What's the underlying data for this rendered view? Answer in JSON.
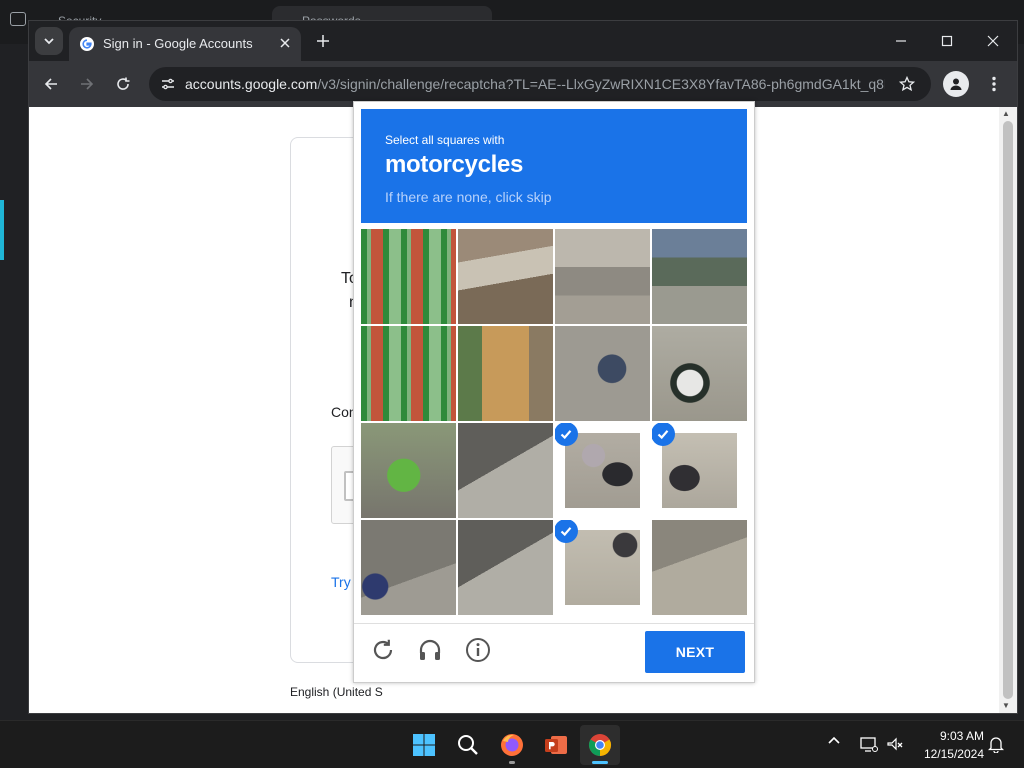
{
  "browser": {
    "tab_title": "Sign in - Google Accounts",
    "url_host": "accounts.google.com",
    "url_path": "/v3/signin/challenge/recaptcha?TL=AE--LlxGyZwRIXN1CE3X8YfavTA86-ph6gmdGA1kt_q8l..."
  },
  "background_tabs": [
    "Security",
    "Passwords"
  ],
  "signin_page": {
    "help_line1": "To hel",
    "help_line2": "make",
    "confirm_label": "Confirm",
    "try_another": "Try anot",
    "language": "English (United S"
  },
  "captcha": {
    "prompt": "Select all squares with",
    "object": "motorcycles",
    "hint": "If there are none, click skip",
    "next_label": "NEXT",
    "tiles": [
      {
        "row": 0,
        "col": 0,
        "selected": false,
        "scene": "green-fence"
      },
      {
        "row": 0,
        "col": 1,
        "selected": false,
        "scene": "stall-roof"
      },
      {
        "row": 0,
        "col": 2,
        "selected": false,
        "scene": "alley-houses"
      },
      {
        "row": 0,
        "col": 3,
        "selected": false,
        "scene": "alley-riders-far"
      },
      {
        "row": 1,
        "col": 0,
        "selected": false,
        "scene": "green-fence"
      },
      {
        "row": 1,
        "col": 1,
        "selected": false,
        "scene": "stall-curtain"
      },
      {
        "row": 1,
        "col": 2,
        "selected": false,
        "scene": "riders-road"
      },
      {
        "row": 1,
        "col": 3,
        "selected": false,
        "scene": "rider-helmet"
      },
      {
        "row": 2,
        "col": 0,
        "selected": false,
        "scene": "green-scooter"
      },
      {
        "row": 2,
        "col": 1,
        "selected": false,
        "scene": "road-shadow"
      },
      {
        "row": 2,
        "col": 2,
        "selected": true,
        "scene": "motorcycle-rear"
      },
      {
        "row": 2,
        "col": 3,
        "selected": true,
        "scene": "motorcycle-side"
      },
      {
        "row": 3,
        "col": 0,
        "selected": false,
        "scene": "scooter-child"
      },
      {
        "row": 3,
        "col": 1,
        "selected": false,
        "scene": "road-shadow"
      },
      {
        "row": 3,
        "col": 2,
        "selected": true,
        "scene": "wheel-road"
      },
      {
        "row": 3,
        "col": 3,
        "selected": false,
        "scene": "road-plain"
      }
    ]
  },
  "taskbar": {
    "time": "9:03 AM",
    "date": "12/15/2024"
  },
  "colors": {
    "captcha_blue": "#1a73e8",
    "chrome_dark": "#202124",
    "link_blue": "#1a73e8"
  },
  "icons": {
    "captcha_controls": [
      "reload-icon",
      "headphones-icon",
      "info-icon"
    ],
    "taskbar_apps": [
      "windows-start-icon",
      "search-icon",
      "firefox-icon",
      "powerpoint-icon",
      "chrome-icon"
    ]
  }
}
